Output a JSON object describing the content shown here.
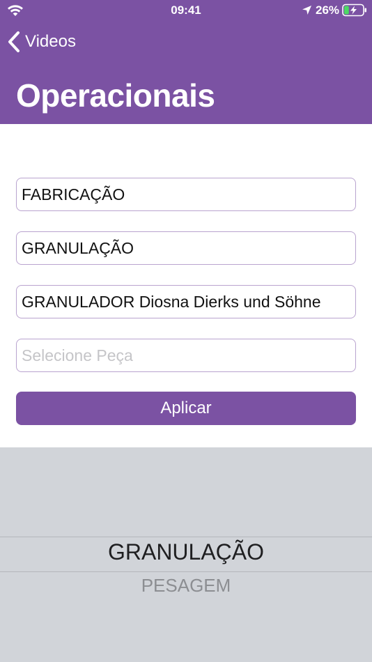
{
  "status_bar": {
    "time": "09:41",
    "battery_percent": "26%",
    "battery_level": 0.26
  },
  "nav": {
    "back_label": "Videos",
    "title": "Operacionais"
  },
  "form": {
    "field_1": {
      "value": "FABRICAÇÃO"
    },
    "field_2": {
      "value": "GRANULAÇÃO"
    },
    "field_3": {
      "value": "GRANULADOR Diosna Dierks und Söhne"
    },
    "field_4": {
      "value": "",
      "placeholder": "Selecione Peça"
    },
    "apply_label": "Aplicar"
  },
  "picker": {
    "selected": "GRANULAÇÃO",
    "next": "PESAGEM"
  },
  "colors": {
    "accent": "#7b52a3",
    "field_border": "#b9a3cf",
    "picker_bg": "#d1d4d9",
    "battery_fill": "#4cd964"
  }
}
